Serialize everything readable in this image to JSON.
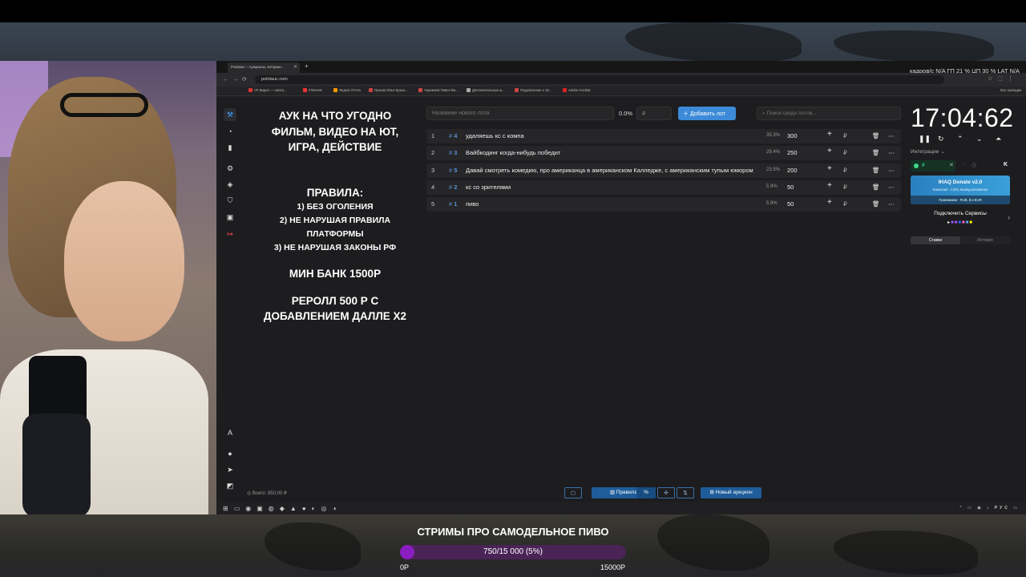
{
  "browser": {
    "tab_title": "Pointauc – Аукционы, которые...",
    "url": "pointauc.com",
    "stats": "кадров/с N/A  ГП 21 %  ЦП 30 %  LAT N/A",
    "bookmarks": [
      "VK Видео — смотр...",
      "Pinterest",
      "Яндекс Почта",
      "Орехов Илья Кузьм...",
      "Черемнов Павел Ва...",
      "Дополнительные м...",
      "Подключение к Эл...",
      "Adobe Acrobat"
    ],
    "bookmarks_right": "Все закладки"
  },
  "rules": {
    "line1": "АУК НА ЧТО УГОДНО",
    "line2": "ФИЛЬМ, ВИДЕО НА ЮТ,",
    "line3": "ИГРА, ДЕЙСТВИЕ",
    "heading": "ПРАВИЛА:",
    "rule1": "1) БЕЗ ОГОЛЕНИЯ",
    "rule2a": "2) НЕ НАРУШАЯ ПРАВИЛА",
    "rule2b": "ПЛАТФОРМЫ",
    "rule3": "3) НЕ НАРУШАЯ ЗАКОНЫ РФ",
    "min_bank": "МИН БАНК 1500Р",
    "reroll1": "РЕРОЛЛ 500 Р С",
    "reroll2": "ДОБАВЛЕНИЕМ ДАЛЛЕ Х2"
  },
  "form": {
    "lot_placeholder": "Название нового лота",
    "percent": "0.0%",
    "amount_placeholder": "₽",
    "add_button": "Добавить лот",
    "search_placeholder": "Поиск среди лотов..."
  },
  "lots": [
    {
      "num": "1",
      "id": "4",
      "name": "удаляешь кс с компа",
      "pct": "35.3%",
      "amount": "300"
    },
    {
      "num": "2",
      "id": "3",
      "name": "Вайбкодинг когда-нибудь победит",
      "pct": "29.4%",
      "amount": "250"
    },
    {
      "num": "3",
      "id": "5",
      "name": "Давай смотреть комедию, про американца в американском Калледже, с американским тупым юмором",
      "pct": "23.5%",
      "amount": "200"
    },
    {
      "num": "4",
      "id": "2",
      "name": "кс со зрителями",
      "pct": "5.9%",
      "amount": "50"
    },
    {
      "num": "5",
      "id": "1",
      "name": "пиво",
      "pct": "5.9%",
      "amount": "50"
    }
  ],
  "timer": {
    "value": "17:04:62"
  },
  "integrations": {
    "label": "Интеграции",
    "donate_title": "IHAQ Donate v2.0",
    "donate_sub": "Комиссия - 3,5%, Вывод мгновенно",
    "donate_strip": "Принимаем - RUB, $ и EUR",
    "connect_title": "Подключить Сервисы",
    "tab_bids": "Ставки",
    "tab_history": "История"
  },
  "footer": {
    "total": "Всего: 850,00 ₽",
    "rules_btn": "Правила",
    "new_auction_btn": "Новый аукцион",
    "tray": "РУС"
  },
  "overlay": {
    "goal_title": "СТРИМЫ ПРО САМОДЕЛЬНОЕ ПИВО",
    "progress_text": "750/15 000 (5%)",
    "progress_fraction": 0.05,
    "min_label": "0Р",
    "max_label": "15000Р"
  },
  "colors": {
    "accent": "#3d8bd8",
    "goal_fill": "#8a1ec2",
    "goal_track": "#4a2457"
  }
}
